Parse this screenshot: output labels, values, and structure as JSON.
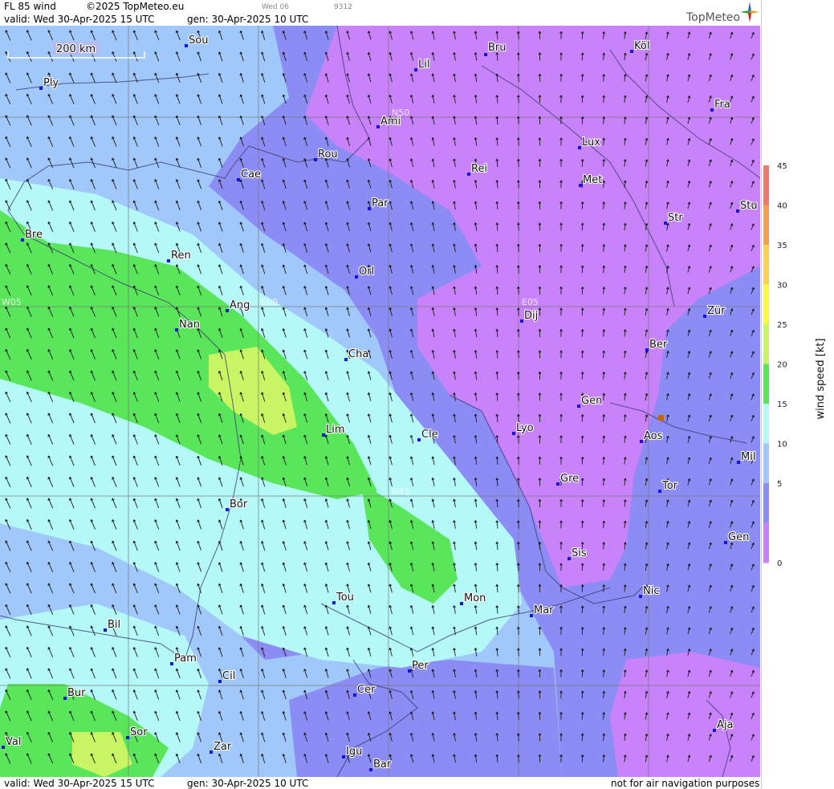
{
  "header": {
    "product": "FL 85 wind",
    "copyright": "©2025 TopMeteo.eu",
    "valid": "valid:  Wed  30-Apr-2025  15 UTC",
    "gen": "gen:  30-Apr-2025  10 UTC",
    "tab_label": "Wed 06",
    "run_code": "9312",
    "brand": "TopMeteo",
    "brand_color": "#555555",
    "logo_icon": "compass-star-icon"
  },
  "scale_bar": {
    "label": "200 km"
  },
  "grid_labels": {
    "n50": "N50",
    "n45": "N45",
    "w05": "W05",
    "e00": "E00",
    "e05": "E05"
  },
  "cities": [
    {
      "name": "Sou"
    },
    {
      "name": "Ply"
    },
    {
      "name": "Lil"
    },
    {
      "name": "Bru"
    },
    {
      "name": "Köl"
    },
    {
      "name": "Ami"
    },
    {
      "name": "Fra"
    },
    {
      "name": "Lux"
    },
    {
      "name": "Rou"
    },
    {
      "name": "Cae"
    },
    {
      "name": "Rei"
    },
    {
      "name": "Met"
    },
    {
      "name": "Par"
    },
    {
      "name": "Stu"
    },
    {
      "name": "Str"
    },
    {
      "name": "Bre"
    },
    {
      "name": "Ren"
    },
    {
      "name": "Orl"
    },
    {
      "name": "Ang"
    },
    {
      "name": "Nan"
    },
    {
      "name": "Dij"
    },
    {
      "name": "Zür"
    },
    {
      "name": "Ber"
    },
    {
      "name": "Cha"
    },
    {
      "name": "Gen"
    },
    {
      "name": "Lim"
    },
    {
      "name": "Cle"
    },
    {
      "name": "Lyo"
    },
    {
      "name": "Aos"
    },
    {
      "name": "Mil"
    },
    {
      "name": "Gre"
    },
    {
      "name": "Tor"
    },
    {
      "name": "Bor"
    },
    {
      "name": "Gen"
    },
    {
      "name": "Sis"
    },
    {
      "name": "Nic"
    },
    {
      "name": "Tou"
    },
    {
      "name": "Mon"
    },
    {
      "name": "Mar"
    },
    {
      "name": "Bil"
    },
    {
      "name": "Pam"
    },
    {
      "name": "Per"
    },
    {
      "name": "Cil"
    },
    {
      "name": "Cer"
    },
    {
      "name": "Bur"
    },
    {
      "name": "Aja"
    },
    {
      "name": "Sor"
    },
    {
      "name": "Val"
    },
    {
      "name": "Zar"
    },
    {
      "name": "Igu"
    },
    {
      "name": "Bar"
    }
  ],
  "legend": {
    "title": "wind  speed  [kt]",
    "ticks": [
      "45",
      "40",
      "35",
      "30",
      "25",
      "20",
      "15",
      "10",
      "5",
      "0"
    ],
    "colors": [
      "#f07868",
      "#f5a04a",
      "#fdd24a",
      "#fafa3c",
      "#c8f564",
      "#5ae65a",
      "#b4f8f8",
      "#a0c8fa",
      "#8c8cf5",
      "#c882fa"
    ]
  },
  "colors": {
    "violet": "#c882fa",
    "indigo": "#8c8cf5",
    "skyblue": "#a0c8fa",
    "cyan": "#b4f8f8",
    "green": "#5ae65a",
    "lime": "#c8f564",
    "city_marker": "#1414dc",
    "aosta_marker": "#c86400"
  },
  "footer": {
    "valid": "valid:  Wed  30-Apr-2025  15 UTC",
    "gen": "gen:  30-Apr-2025  10 UTC",
    "disclaimer": "not for air navigation purposes"
  }
}
